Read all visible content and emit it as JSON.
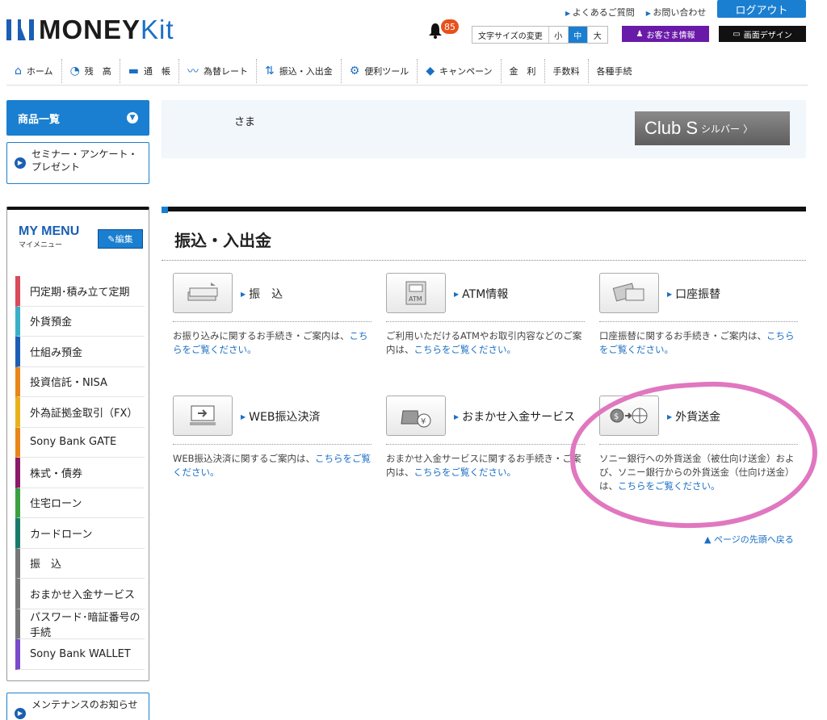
{
  "header": {
    "brand_main": "MONEY",
    "brand_kit": "Kit",
    "links": [
      "よくあるご質問",
      "お問い合わせ"
    ],
    "logout": "ログアウト",
    "notification_count": "85",
    "font_size_label": "文字サイズの変更",
    "font_sizes": [
      "小",
      "中",
      "大"
    ],
    "customer_info": "お客さま情報",
    "screen_design": "画面デザイン"
  },
  "global_nav": [
    {
      "icon": "home-icon",
      "glyph": "⌂",
      "label": "ホーム"
    },
    {
      "icon": "pie-chart-icon",
      "glyph": "◔",
      "label": "残　高"
    },
    {
      "icon": "passbook-icon",
      "glyph": "▬",
      "label": "通　帳"
    },
    {
      "icon": "fx-rate-icon",
      "glyph": "〰",
      "label": "為替レート"
    },
    {
      "icon": "transfer-icon",
      "glyph": "⇅",
      "label": "振込・入出金"
    },
    {
      "icon": "tools-icon",
      "glyph": "⚙",
      "label": "便利ツール"
    },
    {
      "icon": "campaign-icon",
      "glyph": "◆",
      "label": "キャンペーン"
    },
    {
      "icon": "",
      "glyph": "",
      "label": "金　利"
    },
    {
      "icon": "",
      "glyph": "",
      "label": "手数料"
    },
    {
      "icon": "",
      "glyph": "",
      "label": "各種手続"
    }
  ],
  "sidebar": {
    "products_label": "商品一覧",
    "seminar_label": "セミナー・アンケート・プレゼント",
    "my_menu_title": "MY MENU",
    "my_menu_sub": "マイメニュー",
    "edit_label": "編集",
    "items": [
      {
        "label": "円定期･積み立て定期",
        "color": "#d94a5a"
      },
      {
        "label": "外貨預金",
        "color": "#3ab0c8"
      },
      {
        "label": "仕組み預金",
        "color": "#1a5fb4"
      },
      {
        "label": "投資信託・NISA",
        "color": "#e8861a"
      },
      {
        "label": "外為証拠金取引（FX）",
        "color": "#e8b21a"
      },
      {
        "label": "Sony Bank GATE",
        "color": "#e8861a"
      },
      {
        "label": "株式・債券",
        "color": "#8a1a6a"
      },
      {
        "label": "住宅ローン",
        "color": "#3aa040"
      },
      {
        "label": "カードローン",
        "color": "#1a7a6a"
      },
      {
        "label": "振　込",
        "color": "#777777"
      },
      {
        "label": "おまかせ入金サービス",
        "color": "#777777"
      },
      {
        "label": "パスワード･暗証番号の手続",
        "color": "#777777"
      },
      {
        "label": "Sony Bank WALLET",
        "color": "#7a4ac8"
      }
    ],
    "maintenance_label": "メンテナンスのお知らせ"
  },
  "welcome": {
    "suffix": "さま",
    "club_name": "Club S",
    "club_rank": "シルバー"
  },
  "main": {
    "title": "振込・入出金",
    "cards": [
      {
        "title": "振　込",
        "desc_prefix": "お振り込みに関するお手続き・ご案内は、",
        "link": "こちらをご覧ください。"
      },
      {
        "title": "ATM情報",
        "desc_prefix": "ご利用いただけるATMやお取引内容などのご案内は、",
        "link": "こちらをご覧ください。"
      },
      {
        "title": "口座振替",
        "desc_prefix": "口座振替に関するお手続き・ご案内は、",
        "link": "こちらをご覧ください。"
      },
      {
        "title": "WEB振込決済",
        "desc_prefix": "WEB振込決済に関するご案内は、",
        "link": "こちらをご覧ください。"
      },
      {
        "title": "おまかせ入金サービス",
        "desc_prefix": "おまかせ入金サービスに関するお手続き・ご案内は、",
        "link": "こちらをご覧ください。"
      },
      {
        "title": "外貨送金",
        "desc_prefix": "ソニー銀行への外貨送金（被仕向け送金）および、ソニー銀行からの外貨送金（仕向け送金）は、",
        "link": "こちらをご覧ください。"
      }
    ],
    "page_top": "▲ ページの先頭へ戻る"
  },
  "colors": {
    "accent": "#1a7fd0",
    "highlight": "#e077c0"
  }
}
